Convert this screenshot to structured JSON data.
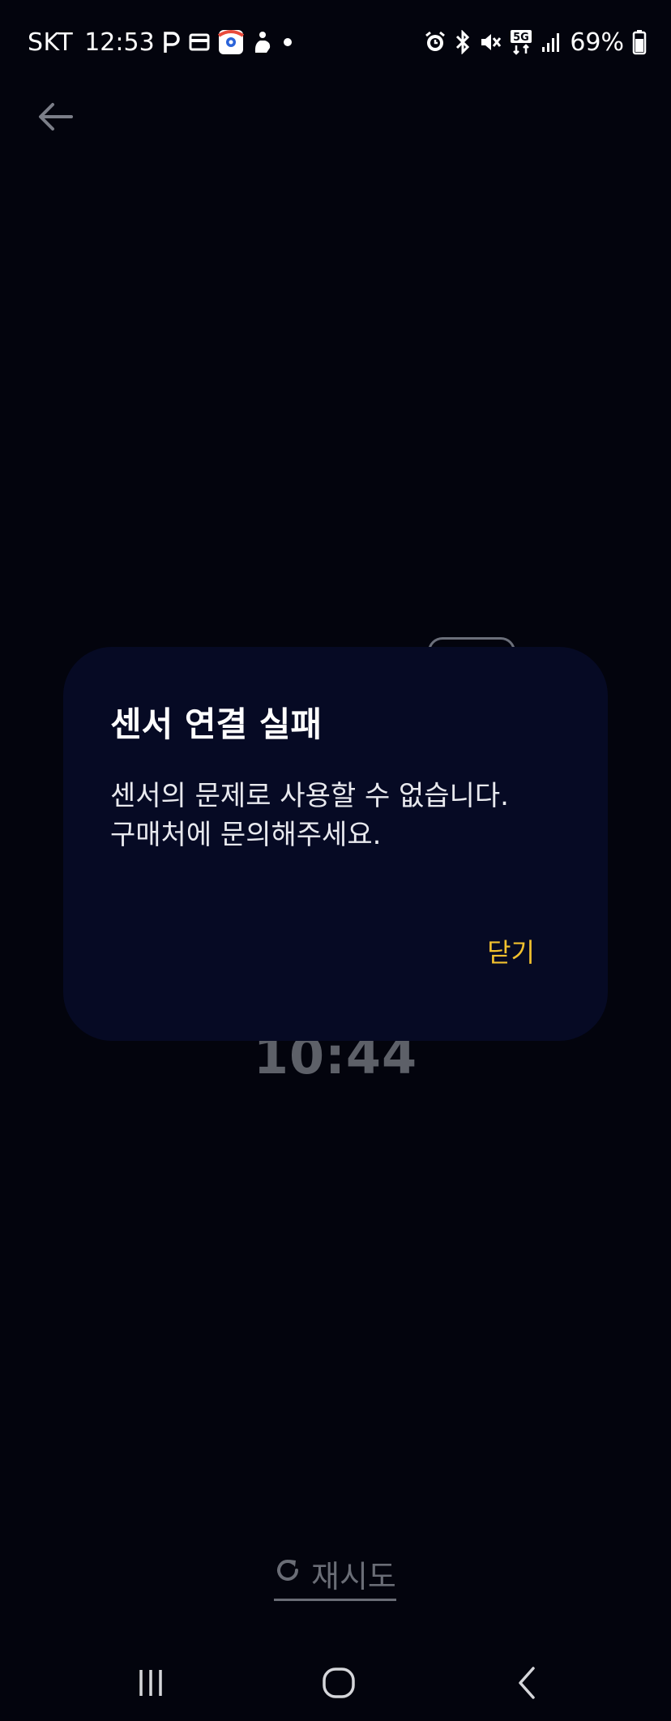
{
  "status_bar": {
    "carrier": "SKT",
    "time": "12:53",
    "network": "5G",
    "battery_percent": "69%",
    "left_icons": [
      "p-icon",
      "card-icon",
      "map-app-icon",
      "hand-icon",
      "dot-icon"
    ],
    "right_icons": [
      "alarm-icon",
      "bluetooth-icon",
      "mute-icon",
      "5g-icon",
      "signal-icon",
      "battery-icon"
    ]
  },
  "header": {
    "back_icon": "arrow-left-icon"
  },
  "background": {
    "timer": "10:44"
  },
  "dialog": {
    "title": "센서 연결 실패",
    "message_line1": "센서의 문제로 사용할 수 없습니다.",
    "message_line2": "구매처에 문의해주세요.",
    "close_label": "닫기"
  },
  "retry": {
    "label": "재시도",
    "icon": "refresh-icon"
  },
  "nav": {
    "recent_icon": "recent-apps-icon",
    "home_icon": "home-icon",
    "back_icon": "back-nav-icon"
  },
  "colors": {
    "background": "#03040d",
    "dialog_bg": "#060a24",
    "accent": "#f2c12e",
    "muted": "#6a6d76"
  }
}
